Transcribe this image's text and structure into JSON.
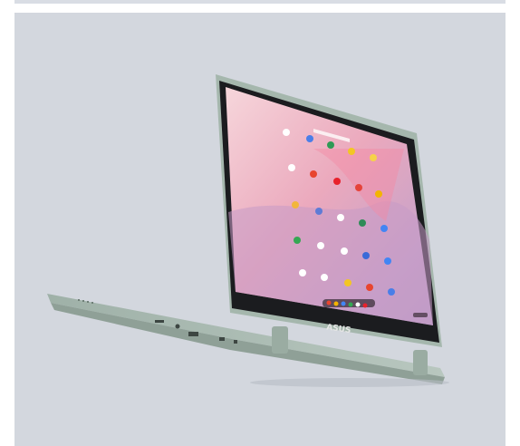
{
  "brand_text": "ASUS",
  "colors": {
    "background": "#d3d7de",
    "chassis": "#a9b9b0",
    "screen_top": "#f4cdd3",
    "screen_mid": "#e9a8bd",
    "screen_bottom": "#c9a0c9"
  },
  "icons": [
    "docs-icon",
    "drive-icon",
    "sheets-icon",
    "slides-icon",
    "keep-icon",
    "maps-icon",
    "gmail-icon",
    "youtube-icon",
    "play-store-icon",
    "chrome-icon",
    "photos-icon",
    "settings-icon",
    "camera-icon",
    "files-icon",
    "meet-icon",
    "calendar-icon",
    "google-icon",
    "web-store-icon",
    "news-icon",
    "assistant-icon"
  ]
}
